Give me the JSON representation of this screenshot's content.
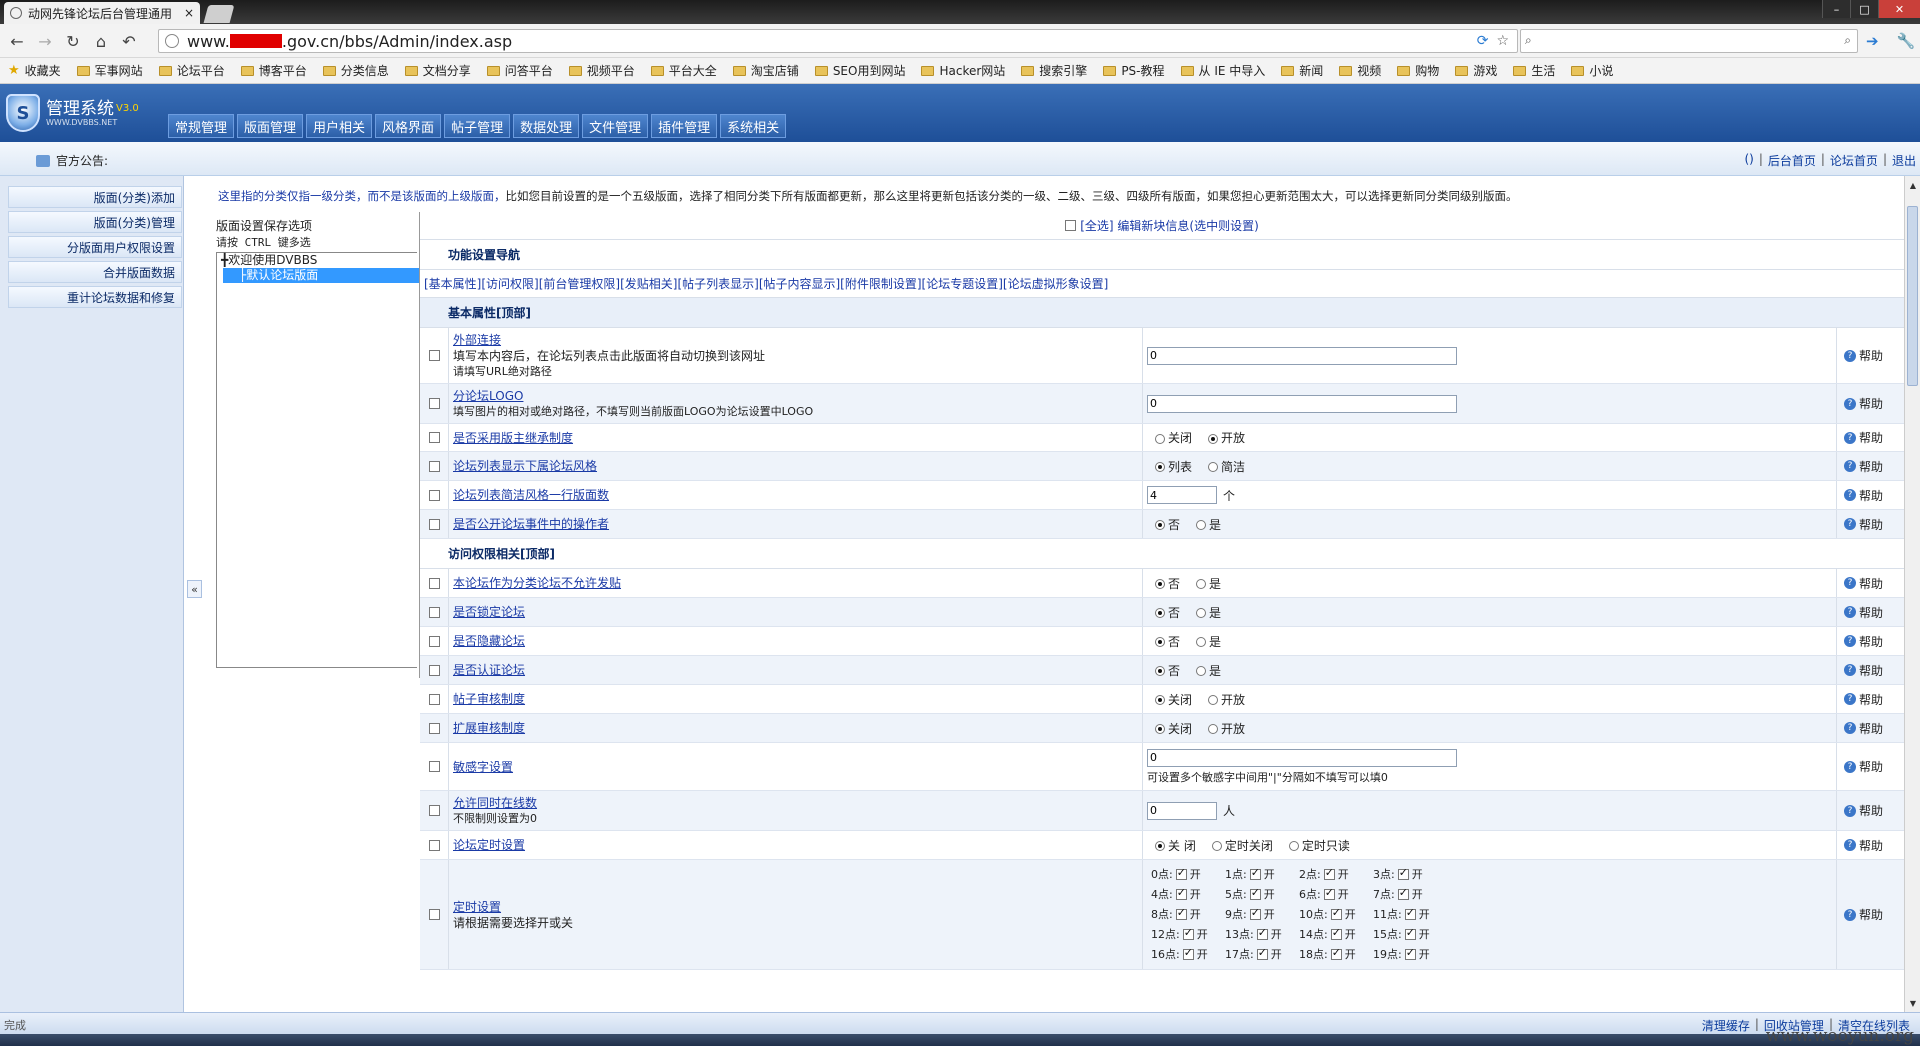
{
  "browser": {
    "tab_title": "动网先锋论坛后台管理通用",
    "tab_close": "×",
    "url_prefix": "www.",
    "url_suffix": ".gov.cn/bbs/Admin/index.asp",
    "status": "完成",
    "window_controls": [
      "–",
      "□",
      "✕"
    ]
  },
  "bookmarks": {
    "favorites": "收藏夹",
    "items": [
      "军事网站",
      "论坛平台",
      "博客平台",
      "分类信息",
      "文档分享",
      "问答平台",
      "视频平台",
      "平台大全",
      "淘宝店铺",
      "SEO用到网站",
      "Hacker网站",
      "搜索引擎",
      "PS-教程",
      "从 IE 中导入",
      "新闻",
      "视频",
      "购物",
      "游戏",
      "生活",
      "小说"
    ]
  },
  "admin": {
    "logo_name": "管理系统",
    "logo_version": "V3.0",
    "logo_sub": "WWW.DVBBS.NET",
    "menu": [
      "常规管理",
      "版面管理",
      "用户相关",
      "风格界面",
      "帖子管理",
      "数据处理",
      "文件管理",
      "插件管理",
      "系统相关"
    ],
    "announce_label": "官方公告:",
    "quick_links": [
      "()",
      "后台首页",
      "论坛首页",
      "退出"
    ],
    "sidebar": [
      "版面(分类)添加",
      "版面(分类)管理",
      "分版面用户权限设置",
      "合并版面数据",
      "重计论坛数据和修复"
    ],
    "collapse": "«",
    "bottom_links": [
      "清理缓存",
      "回收站管理",
      "清空在线列表"
    ]
  },
  "notice": {
    "blue": "这里指的分类仅指一级分类，而不是该版面的上级版面，",
    "rest": "比如您目前设置的是一个五级版面，选择了相同分类下所有版面都更新，那么这里将更新包括该分类的一级、二级、三级、四级所有版面，如果您担心更新范围太大，可以选择更新同分类同级别版面。"
  },
  "board_panel": {
    "hint1": "版面设置保存选项",
    "hint2": "请按 CTRL 键多选",
    "tree": [
      "╋欢迎使用DVBBS",
      "├默认论坛版面"
    ]
  },
  "form": {
    "select_all": "[全选] 编辑新块信息(选中则设置)",
    "nav_title": "功能设置导航",
    "nav_links": "[基本属性][访问权限][前台管理权限][发贴相关][帖子列表显示][帖子内容显示][附件限制设置][论坛专题设置][论坛虚拟形象设置]",
    "help": "帮助",
    "section_basic": "基本属性[顶部]",
    "section_access": "访问权限相关[顶部]",
    "ext_link": {
      "title": "外部连接",
      "desc1": "填写本内容后，在论坛列表点击此版面将自动切换到该网址",
      "desc2": "请填写URL绝对路径",
      "value": "0"
    },
    "logo": {
      "title": "分论坛LOGO",
      "desc": "填写图片的相对或绝对路径，不填写则当前版面LOGO为论坛设置中LOGO",
      "value": "0"
    },
    "inherit": {
      "title": "是否采用版主继承制度",
      "opt1": "关闭",
      "opt2": "开放"
    },
    "list_style": {
      "title": "论坛列表显示下属论坛风格",
      "opt1": "列表",
      "opt2": "简洁"
    },
    "per_row": {
      "title": "论坛列表简洁风格一行版面数",
      "value": "4",
      "unit": "个"
    },
    "public_op": {
      "title": "是否公开论坛事件中的操作者",
      "opt1": "否",
      "opt2": "是"
    },
    "no_post": {
      "title": "本论坛作为分类论坛不允许发贴",
      "opt1": "否",
      "opt2": "是"
    },
    "locked": {
      "title": "是否锁定论坛",
      "opt1": "否",
      "opt2": "是"
    },
    "hidden": {
      "title": "是否隐藏论坛",
      "opt1": "否",
      "opt2": "是"
    },
    "certified": {
      "title": "是否认证论坛",
      "opt1": "否",
      "opt2": "是"
    },
    "audit": {
      "title": "帖子审核制度",
      "opt1": "关闭",
      "opt2": "开放"
    },
    "ext_audit": {
      "title": "扩展审核制度",
      "opt1": "关闭",
      "opt2": "开放"
    },
    "sensitive": {
      "title": "敏感字设置",
      "value": "0",
      "desc": "可设置多个敏感字中间用\"|\"分隔如不填写可以填0"
    },
    "online": {
      "title": "允许同时在线数",
      "desc": "不限制则设置为0",
      "value": "0",
      "unit": "人"
    },
    "timer_mode": {
      "title": "论坛定时设置",
      "opt1": "关 闭",
      "opt2": "定时关闭",
      "opt3": "定时只读"
    },
    "timer": {
      "title": "定时设置",
      "desc": "请根据需要选择开或关",
      "on_label": "开",
      "hours": [
        "0点:",
        "1点:",
        "2点:",
        "3点:",
        "4点:",
        "5点:",
        "6点:",
        "7点:",
        "8点:",
        "9点:",
        "10点:",
        "11点:",
        "12点:",
        "13点:",
        "14点:",
        "15点:",
        "16点:",
        "17点:",
        "18点:",
        "19点:"
      ]
    }
  },
  "watermark": "www.wooyun.org"
}
